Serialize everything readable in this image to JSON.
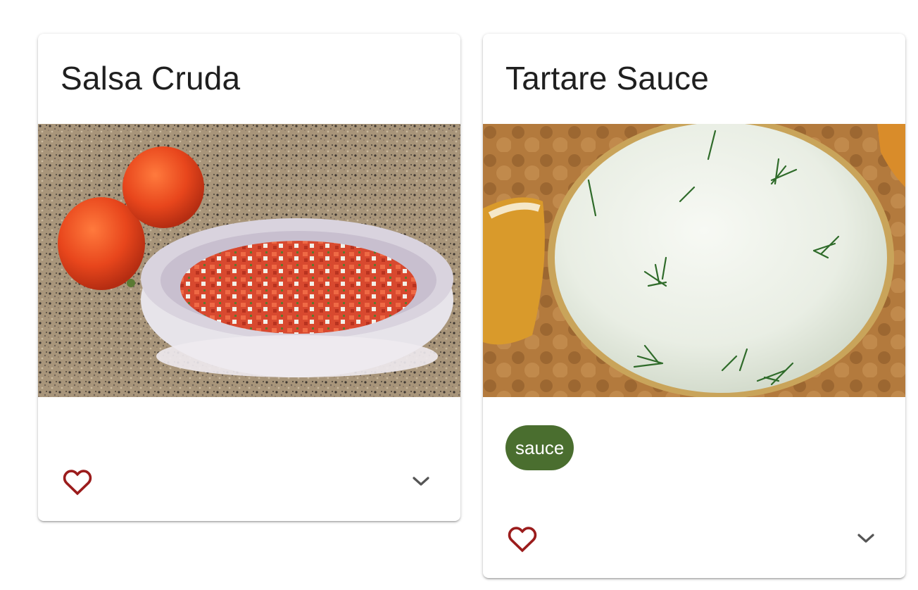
{
  "colors": {
    "favorite": "#9b1c1c",
    "chip_bg": "#4a6e2f",
    "expand": "#555555"
  },
  "recipes": [
    {
      "title": "Salsa Cruda",
      "image_subject": "bowl of salsa cruda beside tomatoes on granite countertop",
      "tags": [],
      "favorite_icon": "heart-outline-icon",
      "expand_icon": "chevron-down-icon"
    },
    {
      "title": "Tartare Sauce",
      "image_subject": "bowl of tartare sauce with dill beside fried fish",
      "tags": [
        "sauce"
      ],
      "favorite_icon": "heart-outline-icon",
      "expand_icon": "chevron-down-icon"
    }
  ]
}
